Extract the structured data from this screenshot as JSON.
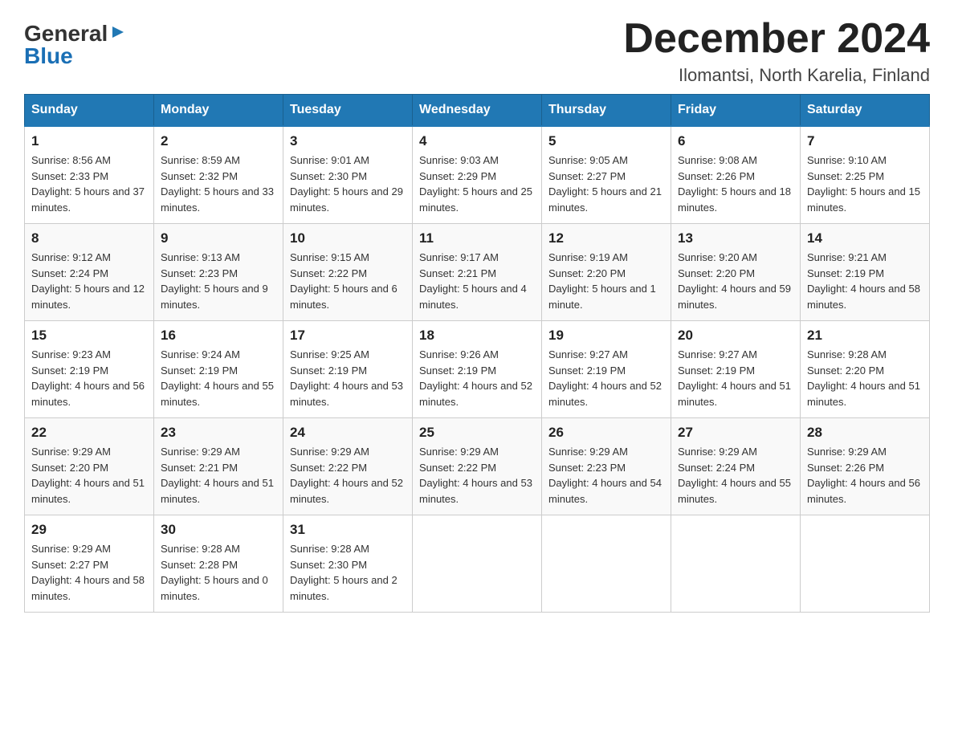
{
  "logo": {
    "general": "General",
    "arrow": "▶",
    "blue": "Blue"
  },
  "title": "December 2024",
  "subtitle": "Ilomantsi, North Karelia, Finland",
  "weekdays": [
    "Sunday",
    "Monday",
    "Tuesday",
    "Wednesday",
    "Thursday",
    "Friday",
    "Saturday"
  ],
  "weeks": [
    [
      {
        "day": "1",
        "sunrise": "8:56 AM",
        "sunset": "2:33 PM",
        "daylight": "5 hours and 37 minutes."
      },
      {
        "day": "2",
        "sunrise": "8:59 AM",
        "sunset": "2:32 PM",
        "daylight": "5 hours and 33 minutes."
      },
      {
        "day": "3",
        "sunrise": "9:01 AM",
        "sunset": "2:30 PM",
        "daylight": "5 hours and 29 minutes."
      },
      {
        "day": "4",
        "sunrise": "9:03 AM",
        "sunset": "2:29 PM",
        "daylight": "5 hours and 25 minutes."
      },
      {
        "day": "5",
        "sunrise": "9:05 AM",
        "sunset": "2:27 PM",
        "daylight": "5 hours and 21 minutes."
      },
      {
        "day": "6",
        "sunrise": "9:08 AM",
        "sunset": "2:26 PM",
        "daylight": "5 hours and 18 minutes."
      },
      {
        "day": "7",
        "sunrise": "9:10 AM",
        "sunset": "2:25 PM",
        "daylight": "5 hours and 15 minutes."
      }
    ],
    [
      {
        "day": "8",
        "sunrise": "9:12 AM",
        "sunset": "2:24 PM",
        "daylight": "5 hours and 12 minutes."
      },
      {
        "day": "9",
        "sunrise": "9:13 AM",
        "sunset": "2:23 PM",
        "daylight": "5 hours and 9 minutes."
      },
      {
        "day": "10",
        "sunrise": "9:15 AM",
        "sunset": "2:22 PM",
        "daylight": "5 hours and 6 minutes."
      },
      {
        "day": "11",
        "sunrise": "9:17 AM",
        "sunset": "2:21 PM",
        "daylight": "5 hours and 4 minutes."
      },
      {
        "day": "12",
        "sunrise": "9:19 AM",
        "sunset": "2:20 PM",
        "daylight": "5 hours and 1 minute."
      },
      {
        "day": "13",
        "sunrise": "9:20 AM",
        "sunset": "2:20 PM",
        "daylight": "4 hours and 59 minutes."
      },
      {
        "day": "14",
        "sunrise": "9:21 AM",
        "sunset": "2:19 PM",
        "daylight": "4 hours and 58 minutes."
      }
    ],
    [
      {
        "day": "15",
        "sunrise": "9:23 AM",
        "sunset": "2:19 PM",
        "daylight": "4 hours and 56 minutes."
      },
      {
        "day": "16",
        "sunrise": "9:24 AM",
        "sunset": "2:19 PM",
        "daylight": "4 hours and 55 minutes."
      },
      {
        "day": "17",
        "sunrise": "9:25 AM",
        "sunset": "2:19 PM",
        "daylight": "4 hours and 53 minutes."
      },
      {
        "day": "18",
        "sunrise": "9:26 AM",
        "sunset": "2:19 PM",
        "daylight": "4 hours and 52 minutes."
      },
      {
        "day": "19",
        "sunrise": "9:27 AM",
        "sunset": "2:19 PM",
        "daylight": "4 hours and 52 minutes."
      },
      {
        "day": "20",
        "sunrise": "9:27 AM",
        "sunset": "2:19 PM",
        "daylight": "4 hours and 51 minutes."
      },
      {
        "day": "21",
        "sunrise": "9:28 AM",
        "sunset": "2:20 PM",
        "daylight": "4 hours and 51 minutes."
      }
    ],
    [
      {
        "day": "22",
        "sunrise": "9:29 AM",
        "sunset": "2:20 PM",
        "daylight": "4 hours and 51 minutes."
      },
      {
        "day": "23",
        "sunrise": "9:29 AM",
        "sunset": "2:21 PM",
        "daylight": "4 hours and 51 minutes."
      },
      {
        "day": "24",
        "sunrise": "9:29 AM",
        "sunset": "2:22 PM",
        "daylight": "4 hours and 52 minutes."
      },
      {
        "day": "25",
        "sunrise": "9:29 AM",
        "sunset": "2:22 PM",
        "daylight": "4 hours and 53 minutes."
      },
      {
        "day": "26",
        "sunrise": "9:29 AM",
        "sunset": "2:23 PM",
        "daylight": "4 hours and 54 minutes."
      },
      {
        "day": "27",
        "sunrise": "9:29 AM",
        "sunset": "2:24 PM",
        "daylight": "4 hours and 55 minutes."
      },
      {
        "day": "28",
        "sunrise": "9:29 AM",
        "sunset": "2:26 PM",
        "daylight": "4 hours and 56 minutes."
      }
    ],
    [
      {
        "day": "29",
        "sunrise": "9:29 AM",
        "sunset": "2:27 PM",
        "daylight": "4 hours and 58 minutes."
      },
      {
        "day": "30",
        "sunrise": "9:28 AM",
        "sunset": "2:28 PM",
        "daylight": "5 hours and 0 minutes."
      },
      {
        "day": "31",
        "sunrise": "9:28 AM",
        "sunset": "2:30 PM",
        "daylight": "5 hours and 2 minutes."
      },
      null,
      null,
      null,
      null
    ]
  ]
}
